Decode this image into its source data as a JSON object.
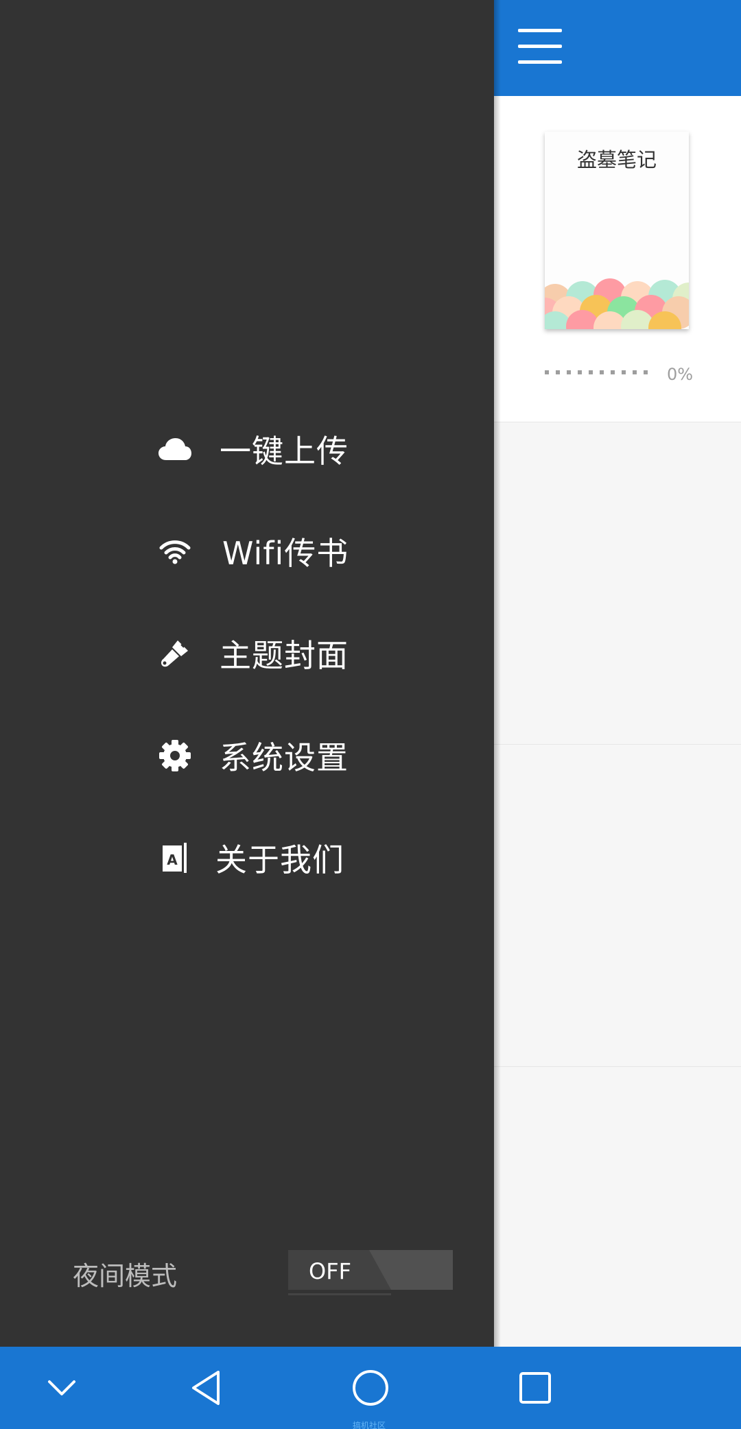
{
  "drawer": {
    "menu": [
      {
        "label": "一键上传",
        "icon": "cloud-icon"
      },
      {
        "label": "Wifi传书",
        "icon": "wifi-icon"
      },
      {
        "label": "主题封面",
        "icon": "paintbrush-icon"
      },
      {
        "label": "系统设置",
        "icon": "gear-icon"
      },
      {
        "label": "关于我们",
        "icon": "about-book-icon"
      }
    ],
    "night_mode": {
      "label": "夜间模式",
      "toggle_text": "OFF"
    }
  },
  "header": {
    "menu_icon": "hamburger-icon"
  },
  "shelf": {
    "books": [
      {
        "title": "盗墓笔记",
        "progress_text": "0%",
        "progress": 0
      }
    ]
  },
  "navbar": {
    "buttons": [
      "chevron-down-icon",
      "back-icon",
      "home-icon",
      "recents-icon"
    ],
    "watermark": "搞机社区"
  },
  "colors": {
    "primary": "#1976d2",
    "drawer_bg": "#333333",
    "content_bg": "#f6f6f6"
  }
}
